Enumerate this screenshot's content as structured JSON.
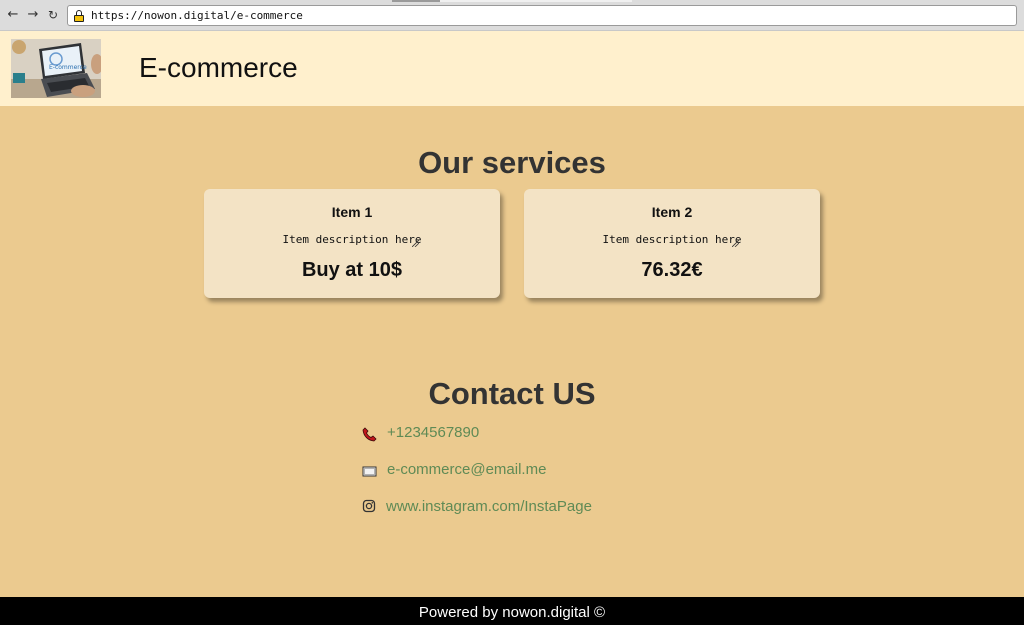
{
  "browser": {
    "url": "https://nowon.digital/e-commerce",
    "back_symbol": "←",
    "forward_symbol": "→",
    "reload_symbol": "↻"
  },
  "header": {
    "title": "E-commerce",
    "logo_text": "E-commerce"
  },
  "services": {
    "heading": "Our services",
    "items": [
      {
        "name": "Item 1",
        "description": "Item description here",
        "price": "Buy at 10$"
      },
      {
        "name": "Item 2",
        "description": "Item description here",
        "price": "76.32€"
      }
    ]
  },
  "contact": {
    "heading": "Contact US",
    "phone": "+1234567890",
    "email": "e-commerce@email.me",
    "instagram": "www.instagram.com/InstaPage"
  },
  "footer": {
    "text": "Powered by nowon.digital ©"
  },
  "colors": {
    "page_background": "#ebca8f",
    "header_background": "#fff0cd",
    "card_background": "#f3e3c5",
    "link": "#5f8a55",
    "footer_background": "#000000"
  }
}
